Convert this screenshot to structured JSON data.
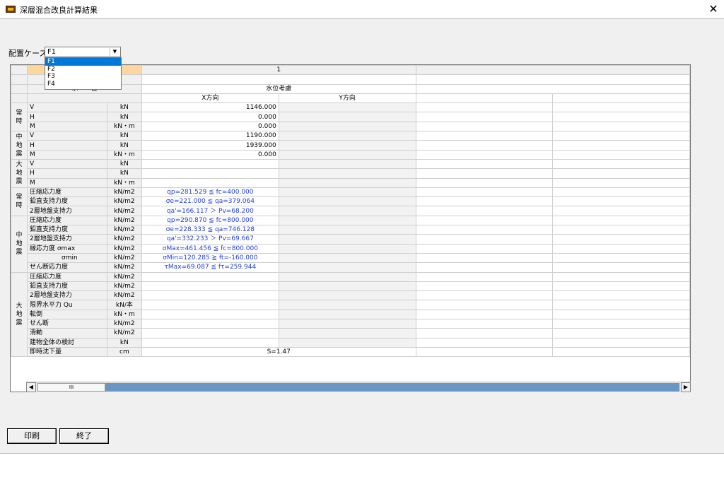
{
  "window": {
    "title": "深層混合改良計算結果"
  },
  "case_selector": {
    "label": "配置ケース",
    "value": "F1",
    "options": [
      "F1",
      "F2",
      "F3",
      "F4"
    ]
  },
  "table": {
    "column_header_number": "1",
    "water_level_label": "水　　位",
    "water_level_value": "水位考慮",
    "direction_x": "X方向",
    "direction_y": "Y方向",
    "groups": {
      "normal": "常\n時",
      "mid_eq": "中\n地\n震",
      "large_eq": "大\n地\n震"
    },
    "load_rows": [
      {
        "item": "V",
        "unit": "kN",
        "x": "1146.000"
      },
      {
        "item": "H",
        "unit": "kN",
        "x": "0.000"
      },
      {
        "item": "M",
        "unit": "kN・m",
        "x": "0.000"
      },
      {
        "item": "V",
        "unit": "kN",
        "x": "1190.000"
      },
      {
        "item": "H",
        "unit": "kN",
        "x": "1939.000"
      },
      {
        "item": "M",
        "unit": "kN・m",
        "x": "0.000"
      },
      {
        "item": "V",
        "unit": "kN",
        "x": ""
      },
      {
        "item": "H",
        "unit": "kN",
        "x": ""
      },
      {
        "item": "M",
        "unit": "kN・m",
        "x": ""
      }
    ],
    "check_rows": [
      {
        "item": "圧縮応力度",
        "unit": "kN/m2",
        "x": "qp=281.529 ≦ fc=400.000"
      },
      {
        "item": "鉛直支持力度",
        "unit": "kN/m2",
        "x": "σe=221.000 ≦ qa=379.064"
      },
      {
        "item": "2層地盤支持力",
        "unit": "kN/m2",
        "x": "qa'=166.117 ＞ Pv=68.200"
      },
      {
        "item": "圧縮応力度",
        "unit": "kN/m2",
        "x": "qp=290.870 ≦ fc=800.000"
      },
      {
        "item": "鉛直支持力度",
        "unit": "kN/m2",
        "x": "σe=228.333 ≦ qa=746.128"
      },
      {
        "item": "2層地盤支持力",
        "unit": "kN/m2",
        "x": "qa'=332.233 ＞ Pv=69.667"
      },
      {
        "item": "縁応力度 σmax",
        "unit": "kN/m2",
        "x": "σMax=461.456 ≦ fc=800.000"
      },
      {
        "item": "σmin",
        "unit": "kN/m2",
        "x": "σMin=120.285 ≧ ft=-160.000"
      },
      {
        "item": "せん断応力度",
        "unit": "kN/m2",
        "x": "τMax=69.087 ≦ fτ=259.944"
      },
      {
        "item": "圧縮応力度",
        "unit": "kN/m2",
        "x": ""
      },
      {
        "item": "鉛直支持力度",
        "unit": "kN/m2",
        "x": ""
      },
      {
        "item": "2層地盤支持力",
        "unit": "kN/m2",
        "x": ""
      },
      {
        "item": "限界水平力 Qu",
        "unit": "kN/本",
        "x": ""
      },
      {
        "item": "転倒",
        "unit": "kN・m",
        "x": ""
      },
      {
        "item": "せん断",
        "unit": "kN/m2",
        "x": ""
      },
      {
        "item": "滑動",
        "unit": "kN/m2",
        "x": ""
      },
      {
        "item": "建物全体の検討",
        "unit": "kN",
        "x": ""
      },
      {
        "item": "即時沈下量",
        "unit": "cm",
        "x": "S=1.47"
      }
    ]
  },
  "buttons": {
    "print": "印刷",
    "exit": "終了"
  },
  "scrollbar": {
    "thumb": "III"
  }
}
